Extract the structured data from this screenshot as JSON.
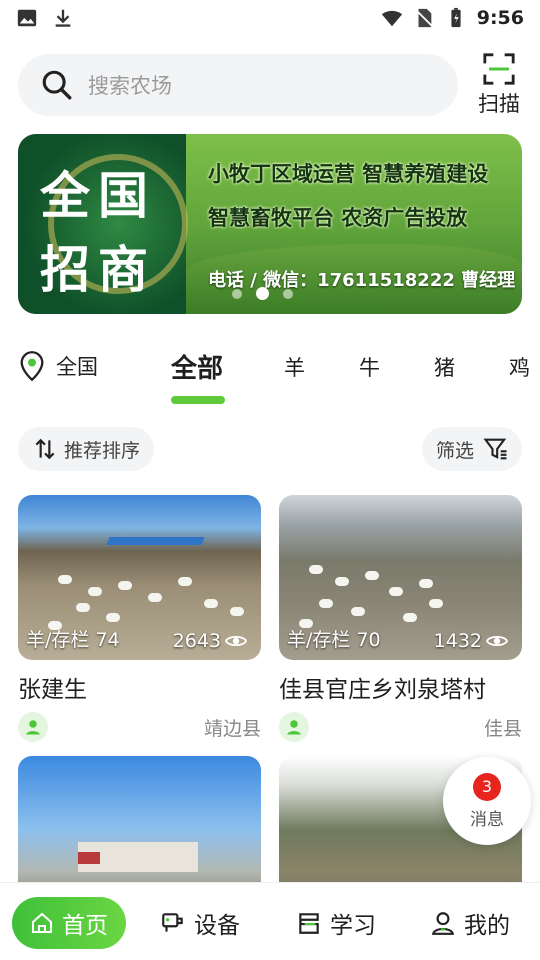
{
  "status_bar": {
    "time": "9:56"
  },
  "search": {
    "placeholder": "搜索农场",
    "scan_label": "扫描"
  },
  "banner": {
    "big_text_1": "全国",
    "big_text_2": "招商",
    "line_1": "小牧丁区域运营 智慧养殖建设",
    "line_2": "智慧畜牧平台   农资广告投放",
    "phone": "电话 / 微信：17611518222 曹经理",
    "slide_count": 3,
    "active_slide": 2
  },
  "categories": {
    "location": "全国",
    "tabs": [
      "全部",
      "羊",
      "牛",
      "猪",
      "鸡"
    ],
    "active_tab": 0
  },
  "toolbar": {
    "sort_label": "推荐排序",
    "filter_label": "筛选"
  },
  "cards": [
    {
      "overlay_left": "羊/存栏 74",
      "views": "2643",
      "title": "张建生",
      "county": "靖边县"
    },
    {
      "overlay_left": "羊/存栏 70",
      "views": "1432",
      "title": "佳县官庄乡刘泉塔村",
      "county": "佳县"
    },
    {
      "overlay_left": "",
      "views": "",
      "title": "",
      "county": ""
    },
    {
      "overlay_left": "",
      "views": "",
      "title": "",
      "county": ""
    }
  ],
  "message": {
    "count": "3",
    "label": "消息"
  },
  "nav": {
    "home": "首页",
    "device": "设备",
    "learn": "学习",
    "mine": "我的"
  },
  "colors": {
    "accent": "#4cc63a",
    "badge": "#e8241f"
  }
}
